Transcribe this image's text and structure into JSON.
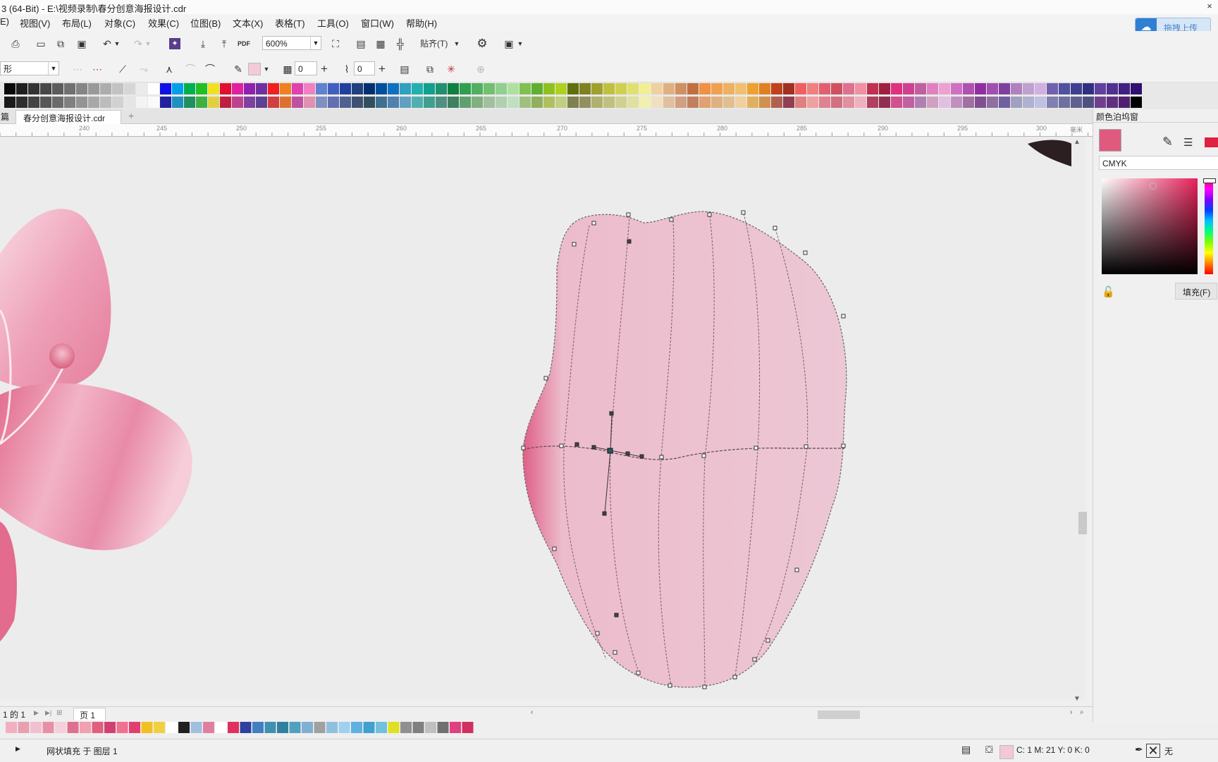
{
  "titlebar": {
    "title": "3 (64-Bit) - E:\\视频录制\\春分创意海报设计.cdr",
    "close": "×"
  },
  "menu": [
    {
      "label": "E)"
    },
    {
      "label": "视图(V)"
    },
    {
      "label": "布局(L)"
    },
    {
      "label": "对象(C)"
    },
    {
      "label": "效果(C)"
    },
    {
      "label": "位图(B)"
    },
    {
      "label": "文本(X)"
    },
    {
      "label": "表格(T)"
    },
    {
      "label": "工具(O)"
    },
    {
      "label": "窗口(W)"
    },
    {
      "label": "帮助(H)"
    }
  ],
  "upload": {
    "label": "拖拽上传"
  },
  "toolbar1": {
    "zoom": "600%",
    "snap_label": "贴齐(T)"
  },
  "toolbar2": {
    "shape_select": "形",
    "smooth_value": "0",
    "transparency_value": "0"
  },
  "icons": {
    "window_close": "close-icon",
    "upload": "cloud-upload-icon",
    "print": "print-icon",
    "undo": "undo-icon",
    "redo": "redo-icon",
    "import": "import-icon",
    "export": "export-icon",
    "pdf": "pdf-icon",
    "full_screen": "full-screen-icon",
    "rulers": "rulers-icon",
    "grid": "grid-icon",
    "guidelines": "guidelines-icon",
    "options": "gear-icon",
    "launch": "launch-icon",
    "eyedropper": "eyedropper-icon",
    "sliders": "sliders-icon",
    "lock": "lock-icon"
  },
  "palette": {
    "row1": [
      "#0a0a0a",
      "#1f1f1f",
      "#333333",
      "#474747",
      "#5c5c5c",
      "#707070",
      "#858585",
      "#999999",
      "#adadad",
      "#c2c2c2",
      "#d6d6d6",
      "#ebebeb",
      "#ffffff",
      "#1010e8",
      "#00a0e9",
      "#00b050",
      "#22c020",
      "#f0e020",
      "#e01030",
      "#e020a0",
      "#9020b0",
      "#7030a0",
      "#ee2020",
      "#f08020",
      "#e040b0",
      "#f080c0",
      "#6080d0",
      "#4060c0",
      "#2040a0",
      "#204080",
      "#003070",
      "#0050a0",
      "#1070c0",
      "#30a0c0",
      "#20b0b0",
      "#10a090",
      "#209070",
      "#108040",
      "#30a050",
      "#50b060",
      "#70c070",
      "#90d090",
      "#b0e0a0",
      "#80c050",
      "#60b030",
      "#90c020",
      "#b0d020",
      "#607010",
      "#808020",
      "#a0a030",
      "#c0c040",
      "#d0d050",
      "#e0e070",
      "#f0f090",
      "#f0d0a0",
      "#e0b080",
      "#d09060",
      "#c07040",
      "#f09040",
      "#f0a050",
      "#f0b060",
      "#f0c070",
      "#f0a030",
      "#e08020",
      "#c04020",
      "#a03020",
      "#f06060",
      "#f08080",
      "#e06070",
      "#d05060",
      "#e07090",
      "#f090a0",
      "#c03050",
      "#a02040",
      "#e03080",
      "#d04090",
      "#c060a0",
      "#e080c0",
      "#f0a0d0",
      "#d070c0",
      "#b050b0",
      "#9030a0",
      "#a050b0",
      "#8040a0",
      "#b080c0",
      "#c0a0d0",
      "#d0b0e0",
      "#7060b0",
      "#5050a0",
      "#404090",
      "#303080",
      "#6040a0",
      "#503090",
      "#402080",
      "#301070"
    ],
    "row2": [
      "#1a1a1a",
      "#2e2e2e",
      "#434343",
      "#575757",
      "#6b6b6b",
      "#808080",
      "#949494",
      "#a8a8a8",
      "#bcbcbc",
      "#d1d1d1",
      "#e5e5e5",
      "#f4f4f4",
      "#fafafa",
      "#2020a0",
      "#2090c0",
      "#209060",
      "#40b040",
      "#e0d040",
      "#c02040",
      "#c04090",
      "#8040a0",
      "#604090",
      "#d04040",
      "#e07030",
      "#c050a0",
      "#e090b0",
      "#8090c0",
      "#6070b0",
      "#506090",
      "#405070",
      "#305060",
      "#407090",
      "#5080b0",
      "#60a0c0",
      "#50b0b0",
      "#40a090",
      "#509080",
      "#408060",
      "#60a070",
      "#80b080",
      "#a0c0a0",
      "#b0d0b0",
      "#c0e0c0",
      "#a0c080",
      "#90b060",
      "#b0c060",
      "#c0d080",
      "#808050",
      "#909060",
      "#b0b070",
      "#c0c080",
      "#d0d090",
      "#e0e0a0",
      "#f0f0b0",
      "#f0e0c0",
      "#e0c0a0",
      "#d0a080",
      "#c08060",
      "#e0a070",
      "#e0b080",
      "#e0c090",
      "#f0d0a0",
      "#e0b060",
      "#d09050",
      "#b06050",
      "#904050",
      "#e08080",
      "#f0a0a0",
      "#e08090",
      "#d07080",
      "#e090a0",
      "#f0b0c0",
      "#b04060",
      "#903050",
      "#d05090",
      "#c060a0",
      "#b080b0",
      "#d0a0c0",
      "#e0c0e0",
      "#c090c0",
      "#a070a0",
      "#805090",
      "#9070a0",
      "#7060a0",
      "#a0a0c0",
      "#b0b0d0",
      "#c0c0e0",
      "#8080b0",
      "#7070a0",
      "#606090",
      "#505080",
      "#704090",
      "#603080",
      "#502070",
      "#000000"
    ]
  },
  "tabs": {
    "left_label": "篇",
    "doc_name": "春分创意海报设计.cdr",
    "add": "+"
  },
  "ruler": {
    "labels": [
      "240",
      "245",
      "250",
      "255",
      "260",
      "265",
      "270",
      "275",
      "280",
      "285",
      "290",
      "295",
      "300"
    ],
    "unit": "毫米"
  },
  "docker": {
    "title": "颜色泊坞窗",
    "swatch_color": "#e05a80",
    "model": "CMYK",
    "fill_button": "填充(F)",
    "gradient_hue": "#e8225a"
  },
  "pages": {
    "count_label": "1 的 1",
    "page_tab": "页 1"
  },
  "doc_palette": [
    "#f0b0c0",
    "#e8a0b0",
    "#f0c0d0",
    "#e890a8",
    "#f4d0dc",
    "#e07090",
    "#f0a0b0",
    "#e06080",
    "#d04070",
    "#f07090",
    "#e04070",
    "#f0c020",
    "#f0d040",
    "#ffffff",
    "#202020",
    "#a0c0e0",
    "#e080a0",
    "#ffffff",
    "#e03060",
    "#3040a0",
    "#4080c0",
    "#4090b0",
    "#3080a0",
    "#50a0c0",
    "#80b0d0",
    "#a0a0a0",
    "#90c0e0",
    "#a0d0f0",
    "#60b0e0",
    "#40a0d0",
    "#70c0e0",
    "#e0e020",
    "#909090",
    "#808080",
    "#c0c0c0",
    "#707070",
    "#e04080",
    "#d03060"
  ],
  "status": {
    "left": "网状填充 于 图层 1",
    "color_readout": "C: 1 M: 21 Y: 0 K: 0",
    "outline": "无",
    "fill_swatch": "#f4c8d4"
  }
}
